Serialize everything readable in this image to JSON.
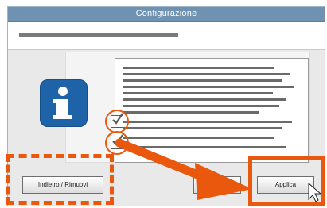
{
  "window": {
    "title": "Configurazione"
  },
  "buttons": {
    "left_label": "Indietro / Rimuovi",
    "middle_label": "",
    "apply_label": "Applica"
  },
  "colors": {
    "title_bar": "#6f91b2",
    "highlight": "#e9580c",
    "info_icon": "#1e63a7"
  },
  "icons": {
    "info": "info-icon",
    "cursor": "mouse-pointer-icon"
  }
}
